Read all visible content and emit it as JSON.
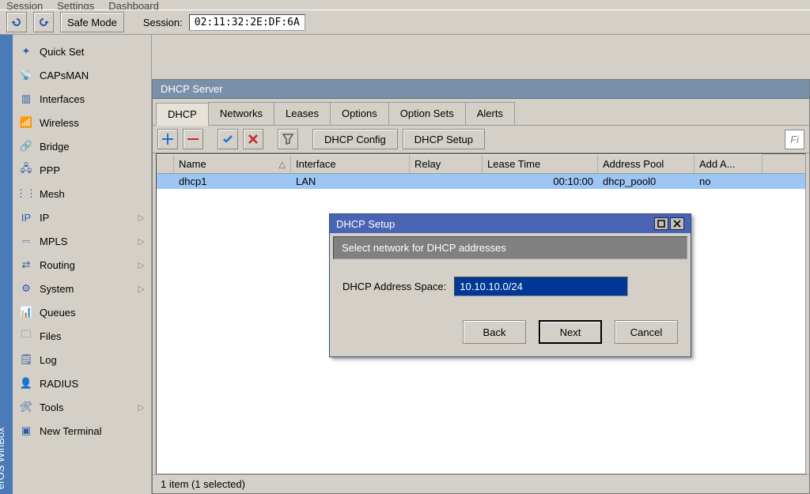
{
  "menubar": {
    "items": [
      "Session",
      "Settings",
      "Dashboard"
    ]
  },
  "toolbar": {
    "safe_mode": "Safe Mode",
    "session_label": "Session:",
    "session_value": "02:11:32:2E:DF:6A"
  },
  "brand": "erOS WinBox",
  "sidebar": {
    "items": [
      {
        "label": "Quick Set",
        "icon": "magic"
      },
      {
        "label": "CAPsMAN",
        "icon": "tower"
      },
      {
        "label": "Interfaces",
        "icon": "ports"
      },
      {
        "label": "Wireless",
        "icon": "wifi"
      },
      {
        "label": "Bridge",
        "icon": "bridge"
      },
      {
        "label": "PPP",
        "icon": "ppp"
      },
      {
        "label": "Mesh",
        "icon": "mesh"
      },
      {
        "label": "IP",
        "icon": "ip",
        "sub": true
      },
      {
        "label": "MPLS",
        "icon": "mpls",
        "sub": true
      },
      {
        "label": "Routing",
        "icon": "routing",
        "sub": true
      },
      {
        "label": "System",
        "icon": "system",
        "sub": true
      },
      {
        "label": "Queues",
        "icon": "queues"
      },
      {
        "label": "Files",
        "icon": "files"
      },
      {
        "label": "Log",
        "icon": "log"
      },
      {
        "label": "RADIUS",
        "icon": "radius"
      },
      {
        "label": "Tools",
        "icon": "tools",
        "sub": true
      },
      {
        "label": "New Terminal",
        "icon": "terminal"
      }
    ]
  },
  "window": {
    "title": "DHCP Server",
    "tabs": [
      "DHCP",
      "Networks",
      "Leases",
      "Options",
      "Option Sets",
      "Alerts"
    ],
    "active_tab": 0,
    "buttons": {
      "dhcp_config": "DHCP Config",
      "dhcp_setup": "DHCP Setup"
    },
    "find_placeholder": "Fi",
    "columns": [
      "Name",
      "Interface",
      "Relay",
      "Lease Time",
      "Address Pool",
      "Add A..."
    ],
    "rows": [
      {
        "name": "dhcp1",
        "interface": "LAN",
        "relay": "",
        "lease_time": "00:10:00",
        "address_pool": "dhcp_pool0",
        "add_arp": "no"
      }
    ],
    "status": "1 item (1 selected)"
  },
  "dialog": {
    "title": "DHCP Setup",
    "banner": "Select network for DHCP addresses",
    "field_label": "DHCP Address Space:",
    "field_value": "10.10.10.0/24",
    "back": "Back",
    "next": "Next",
    "cancel": "Cancel"
  }
}
